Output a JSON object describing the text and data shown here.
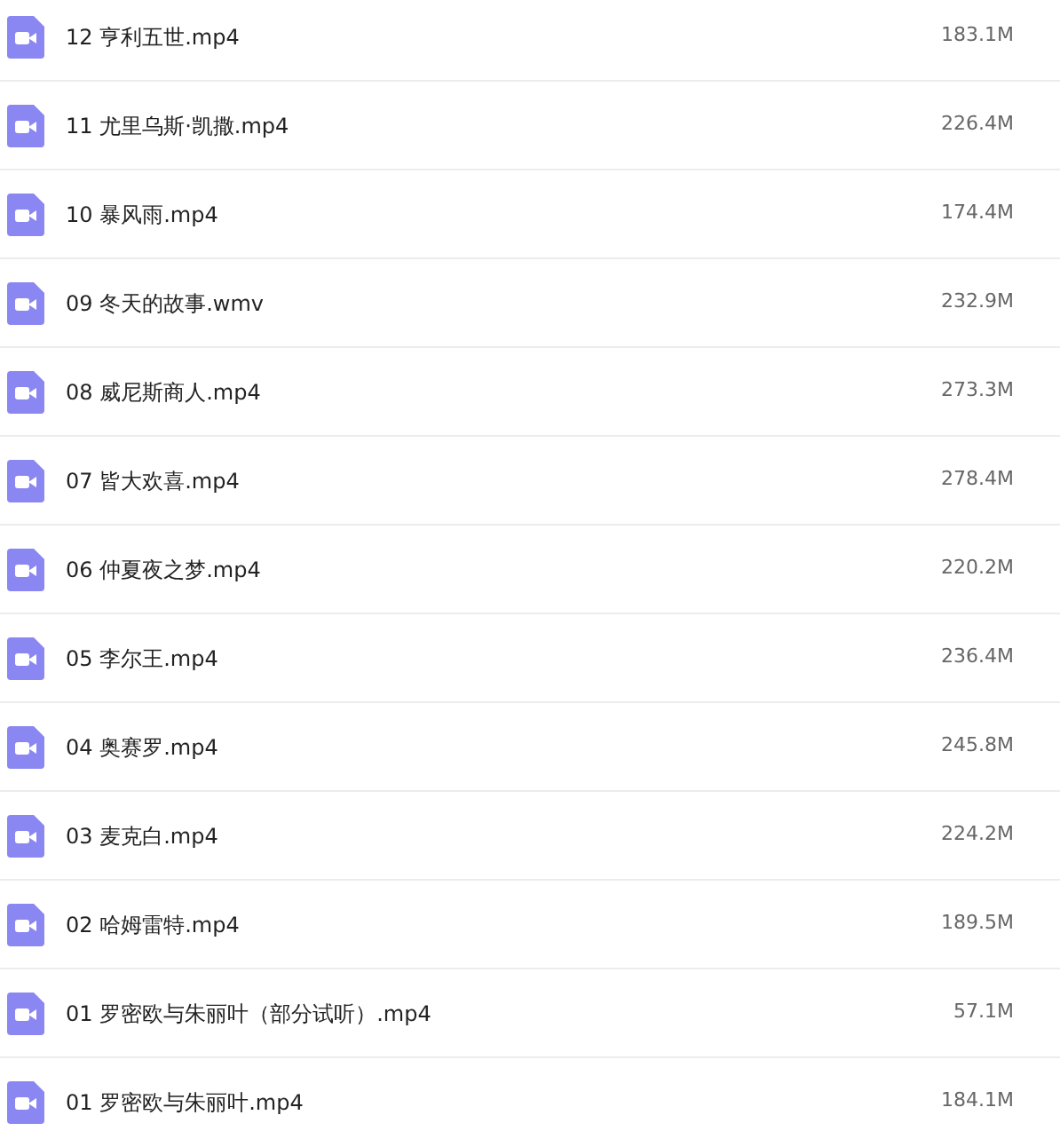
{
  "files": [
    {
      "name": "12 亨利五世.mp4",
      "size": "183.1M"
    },
    {
      "name": "11 尤里乌斯·凯撒.mp4",
      "size": "226.4M"
    },
    {
      "name": "10 暴风雨.mp4",
      "size": "174.4M"
    },
    {
      "name": "09 冬天的故事.wmv",
      "size": "232.9M"
    },
    {
      "name": "08 威尼斯商人.mp4",
      "size": "273.3M"
    },
    {
      "name": "07 皆大欢喜.mp4",
      "size": "278.4M"
    },
    {
      "name": "06 仲夏夜之梦.mp4",
      "size": "220.2M"
    },
    {
      "name": "05 李尔王.mp4",
      "size": "236.4M"
    },
    {
      "name": "04 奥赛罗.mp4",
      "size": "245.8M"
    },
    {
      "name": "03 麦克白.mp4",
      "size": "224.2M"
    },
    {
      "name": "02 哈姆雷特.mp4",
      "size": "189.5M"
    },
    {
      "name": "01 罗密欧与朱丽叶（部分试听）.mp4",
      "size": "57.1M"
    },
    {
      "name": "01 罗密欧与朱丽叶.mp4",
      "size": "184.1M"
    }
  ]
}
